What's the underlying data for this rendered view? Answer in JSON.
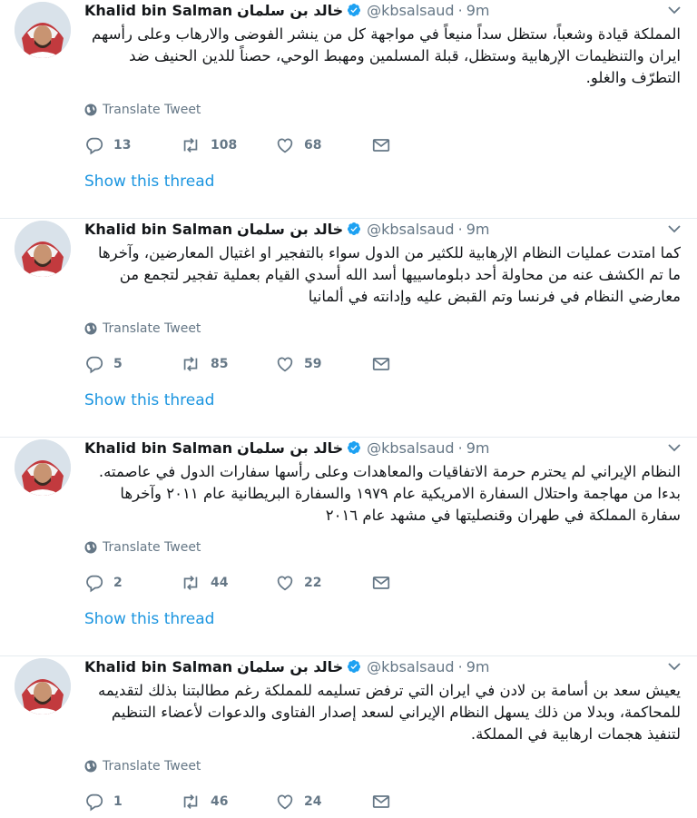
{
  "tweets": [
    {
      "name": "Khalid bin Salman",
      "name_ar": "خالد بن سلمان",
      "handle": "@kbsalsaud",
      "time": "9m",
      "text": "المملكة قيادة وشعباً، ستظل سداً منيعاً في مواجهة كل من ينشر الفوضى والارهاب وعلى رأسهم ايران والتنظيمات الإرهابية  وستظل، قبلة المسلمين ومهبط الوحي، حصناً للدين الحنيف ضد التطرّف والغلو.",
      "translate": "Translate Tweet",
      "replies": "13",
      "retweets": "108",
      "likes": "68",
      "show_thread": "Show this thread"
    },
    {
      "name": "Khalid bin Salman",
      "name_ar": "خالد بن سلمان",
      "handle": "@kbsalsaud",
      "time": "9m",
      "text": "كما امتدت عمليات النظام الإرهابية للكثير من الدول سواء بالتفجير او اغتيال المعارضين، وآخرها ما تم الكشف عنه من محاولة أحد دبلوماسييها أسد الله أسدي القيام بعملية تفجير لتجمع من معارضي النظام في فرنسا وتم القبض عليه وإدانته في ألمانيا",
      "translate": "Translate Tweet",
      "replies": "5",
      "retweets": "85",
      "likes": "59",
      "show_thread": "Show this thread"
    },
    {
      "name": "Khalid bin Salman",
      "name_ar": "خالد بن سلمان",
      "handle": "@kbsalsaud",
      "time": "9m",
      "text": "النظام الإيراني لم يحترم حرمة الاتفاقيات والمعاهدات وعلى رأسها سفارات الدول في عاصمته. بدءا من مهاجمة واحتلال السفارة الامريكية عام ١٩٧٩ والسفارة البريطانية عام ٢٠١١ وآخرها سفارة المملكة في طهران وقنصليتها في مشهد عام ٢٠١٦",
      "translate": "Translate Tweet",
      "replies": "2",
      "retweets": "44",
      "likes": "22",
      "show_thread": "Show this thread"
    },
    {
      "name": "Khalid bin Salman",
      "name_ar": "خالد بن سلمان",
      "handle": "@kbsalsaud",
      "time": "9m",
      "text": "يعيش سعد بن أسامة بن لادن في ايران التي ترفض تسليمه للمملكة رغم مطالبتنا بذلك لتقديمه للمحاكمة، وبدلا من ذلك يسهل النظام الإيراني لسعد إصدار الفتاوى والدعوات لأعضاء التنظيم لتنفيذ هجمات ارهابية في المملكة.",
      "translate": "Translate Tweet",
      "replies": "1",
      "retweets": "46",
      "likes": "24"
    }
  ],
  "colors": {
    "link": "#1b95e0",
    "muted": "#657786",
    "verified": "#1da1f2",
    "divider": "#e6ecf0"
  },
  "icons": [
    "verified-badge-icon",
    "chevron-down-icon",
    "globe-icon",
    "reply-icon",
    "retweet-icon",
    "like-icon",
    "direct-message-icon"
  ]
}
